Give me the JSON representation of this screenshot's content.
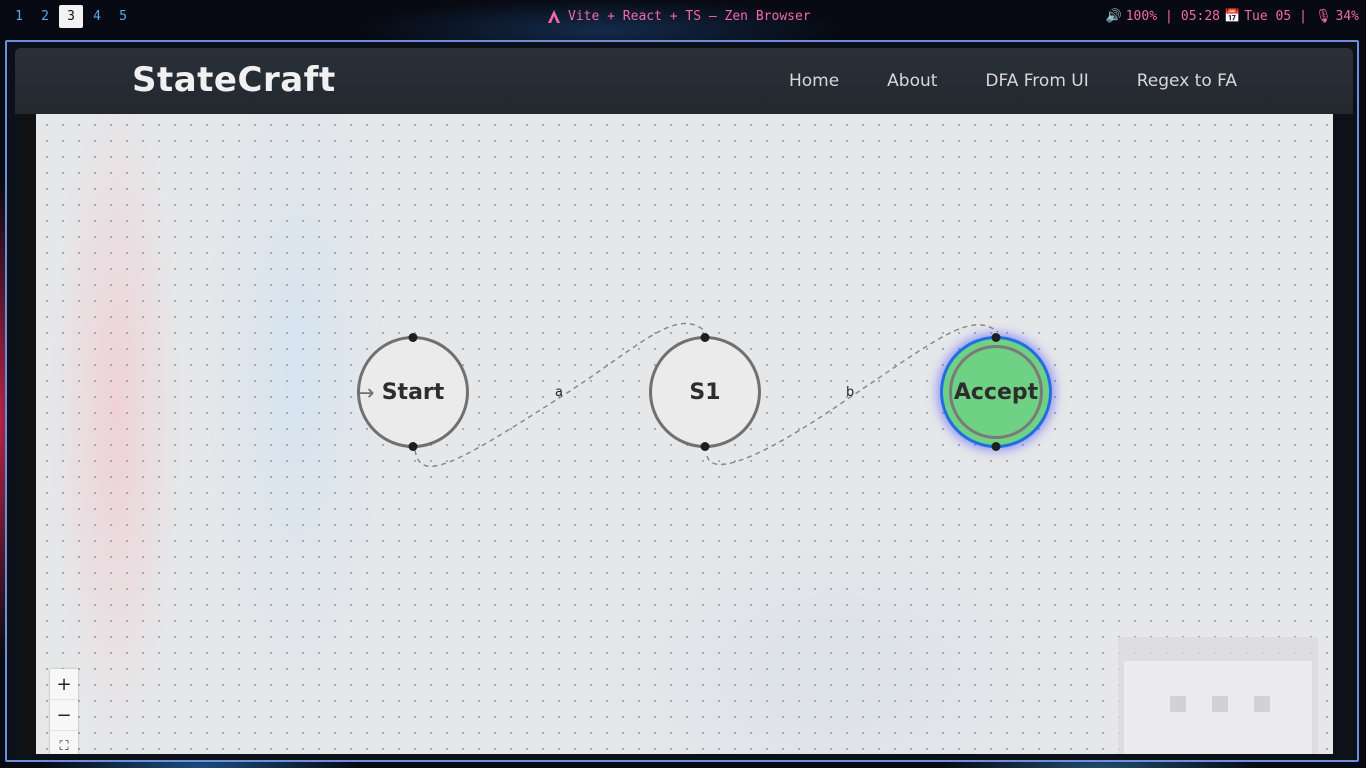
{
  "topbar": {
    "workspaces": [
      "1",
      "2",
      "3",
      "4",
      "5"
    ],
    "active_workspace": "3",
    "window_title": "Vite + React + TS — Zen Browser",
    "volume": "100%",
    "time": "05:28",
    "date": "Tue 05",
    "battery": "34%",
    "separator": "|"
  },
  "app": {
    "brand": "StateCraft",
    "nav": [
      "Home",
      "About",
      "DFA From UI",
      "Regex to FA"
    ]
  },
  "states": [
    {
      "label": "Start",
      "type": "start"
    },
    {
      "label": "S1",
      "type": "normal"
    },
    {
      "label": "Accept",
      "type": "accept"
    }
  ],
  "transitions": [
    {
      "from": "Start",
      "to": "S1",
      "symbol": "a"
    },
    {
      "from": "S1",
      "to": "Accept",
      "symbol": "b"
    }
  ],
  "controls": {
    "zoom_in": "+",
    "zoom_out": "−",
    "fit": "⛶"
  },
  "colors": {
    "accent": "#f06aa8",
    "workspace": "#5aa8e8",
    "accept_fill": "#6fd183",
    "accept_border": "#1f6fe0"
  }
}
